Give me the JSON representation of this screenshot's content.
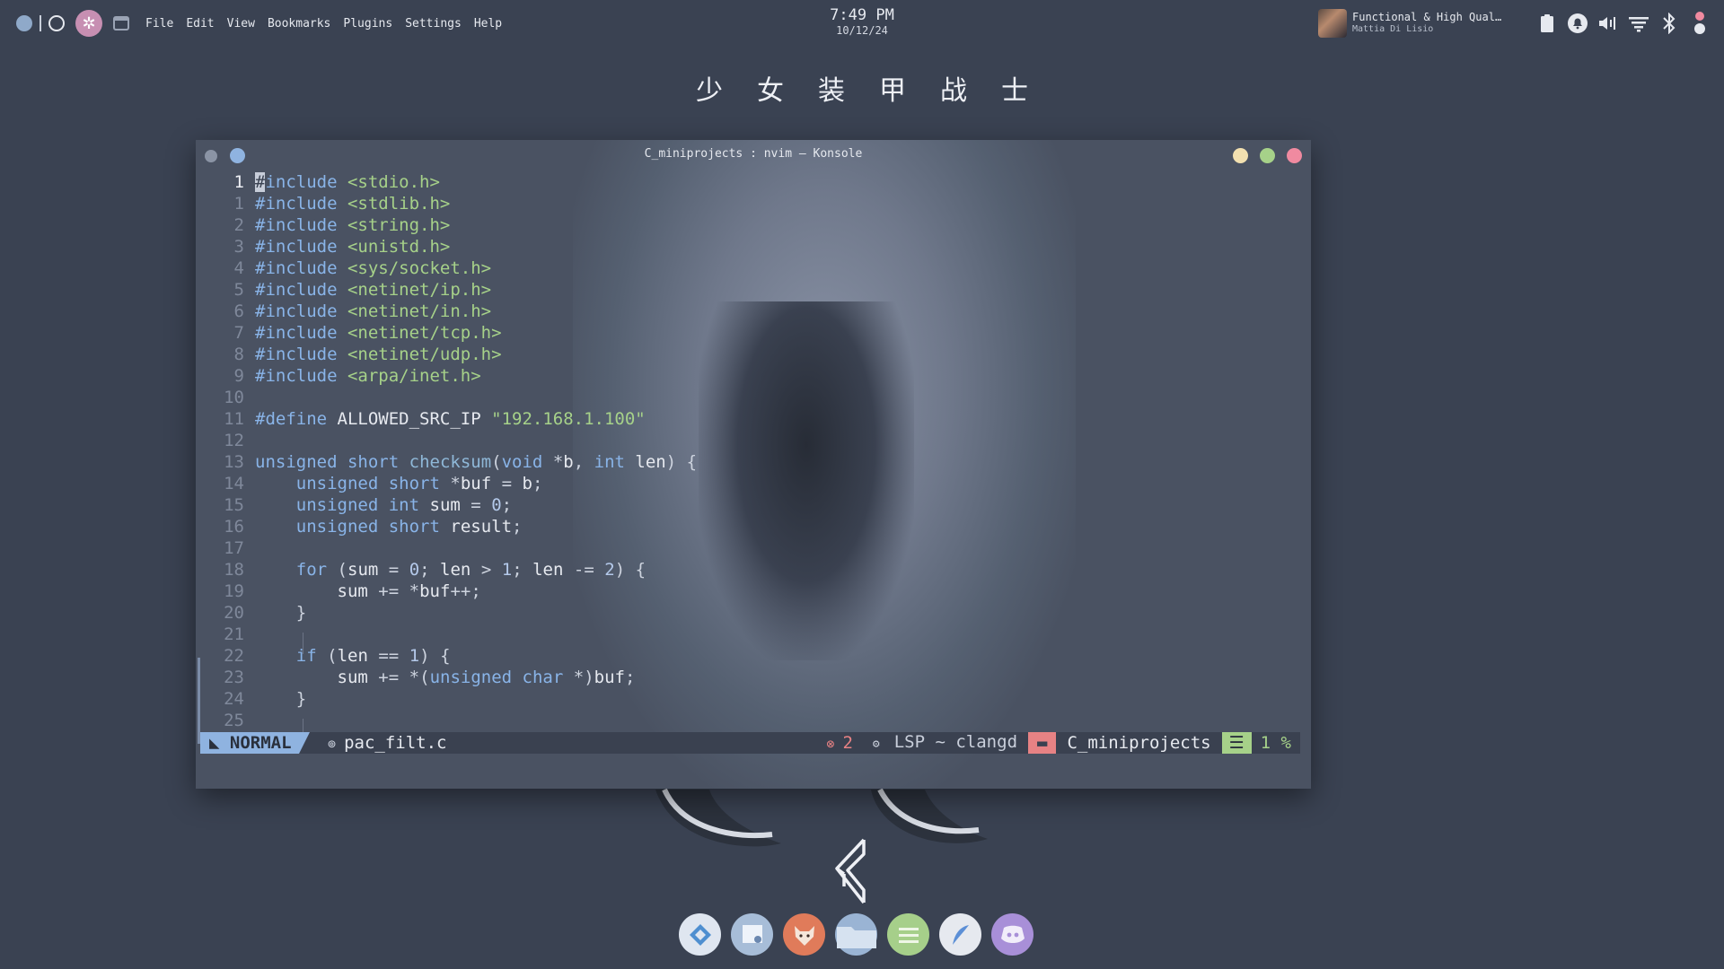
{
  "menu": [
    "File",
    "Edit",
    "View",
    "Bookmarks",
    "Plugins",
    "Settings",
    "Help"
  ],
  "clock": {
    "time": "7:49 PM",
    "date": "10/12/24"
  },
  "media": {
    "title": "Functional & High Qual…",
    "artist": "Mattia Di Lisio"
  },
  "desktop_title": "少女装甲战士",
  "window": {
    "title": "C_miniprojects : nvim — Konsole",
    "buttons": {
      "minimize": "#f2e0b0",
      "maximize": "#a6d189",
      "close": "#f08aa0"
    }
  },
  "editor": {
    "lines": [
      {
        "n": "1",
        "code": "#include <stdio.h>"
      },
      {
        "n": "1",
        "code": "#include <stdlib.h>"
      },
      {
        "n": "2",
        "code": "#include <string.h>"
      },
      {
        "n": "3",
        "code": "#include <unistd.h>"
      },
      {
        "n": "4",
        "code": "#include <sys/socket.h>"
      },
      {
        "n": "5",
        "code": "#include <netinet/ip.h>"
      },
      {
        "n": "6",
        "code": "#include <netinet/in.h>"
      },
      {
        "n": "7",
        "code": "#include <netinet/tcp.h>"
      },
      {
        "n": "8",
        "code": "#include <netinet/udp.h>"
      },
      {
        "n": "9",
        "code": "#include <arpa/inet.h>"
      },
      {
        "n": "10",
        "code": ""
      },
      {
        "n": "11",
        "code": "#define ALLOWED_SRC_IP \"192.168.1.100\""
      },
      {
        "n": "12",
        "code": ""
      },
      {
        "n": "13",
        "code": "unsigned short checksum(void *b, int len) {"
      },
      {
        "n": "14",
        "code": "    unsigned short *buf = b;"
      },
      {
        "n": "15",
        "code": "    unsigned int sum = 0;"
      },
      {
        "n": "16",
        "code": "    unsigned short result;"
      },
      {
        "n": "17",
        "code": ""
      },
      {
        "n": "18",
        "code": "    for (sum = 0; len > 1; len -= 2) {"
      },
      {
        "n": "19",
        "code": "        sum += *buf++;"
      },
      {
        "n": "20",
        "code": "    }"
      },
      {
        "n": "21",
        "code": ""
      },
      {
        "n": "22",
        "code": "    if (len == 1) {"
      },
      {
        "n": "23",
        "code": "        sum += *(unsigned char *)buf;"
      },
      {
        "n": "24",
        "code": "    }"
      },
      {
        "n": "25",
        "code": ""
      }
    ]
  },
  "statusline": {
    "mode": "NORMAL",
    "file": "pac_filt.c",
    "errors": "2",
    "lsp": "LSP ~ clangd",
    "project": "C_miniprojects",
    "position": "1 %"
  },
  "dock": [
    {
      "name": "vscodium-icon",
      "color": "#dfe6f0"
    },
    {
      "name": "software-store-icon",
      "color": "#a7bdd8"
    },
    {
      "name": "firefox-icon",
      "color": "#e07b5a"
    },
    {
      "name": "files-icon",
      "color": "#9ab4d4"
    },
    {
      "name": "notes-icon",
      "color": "#a6cf8a"
    },
    {
      "name": "quill-icon",
      "color": "#e6e9ef"
    },
    {
      "name": "discord-icon",
      "color": "#a88fd8"
    }
  ]
}
